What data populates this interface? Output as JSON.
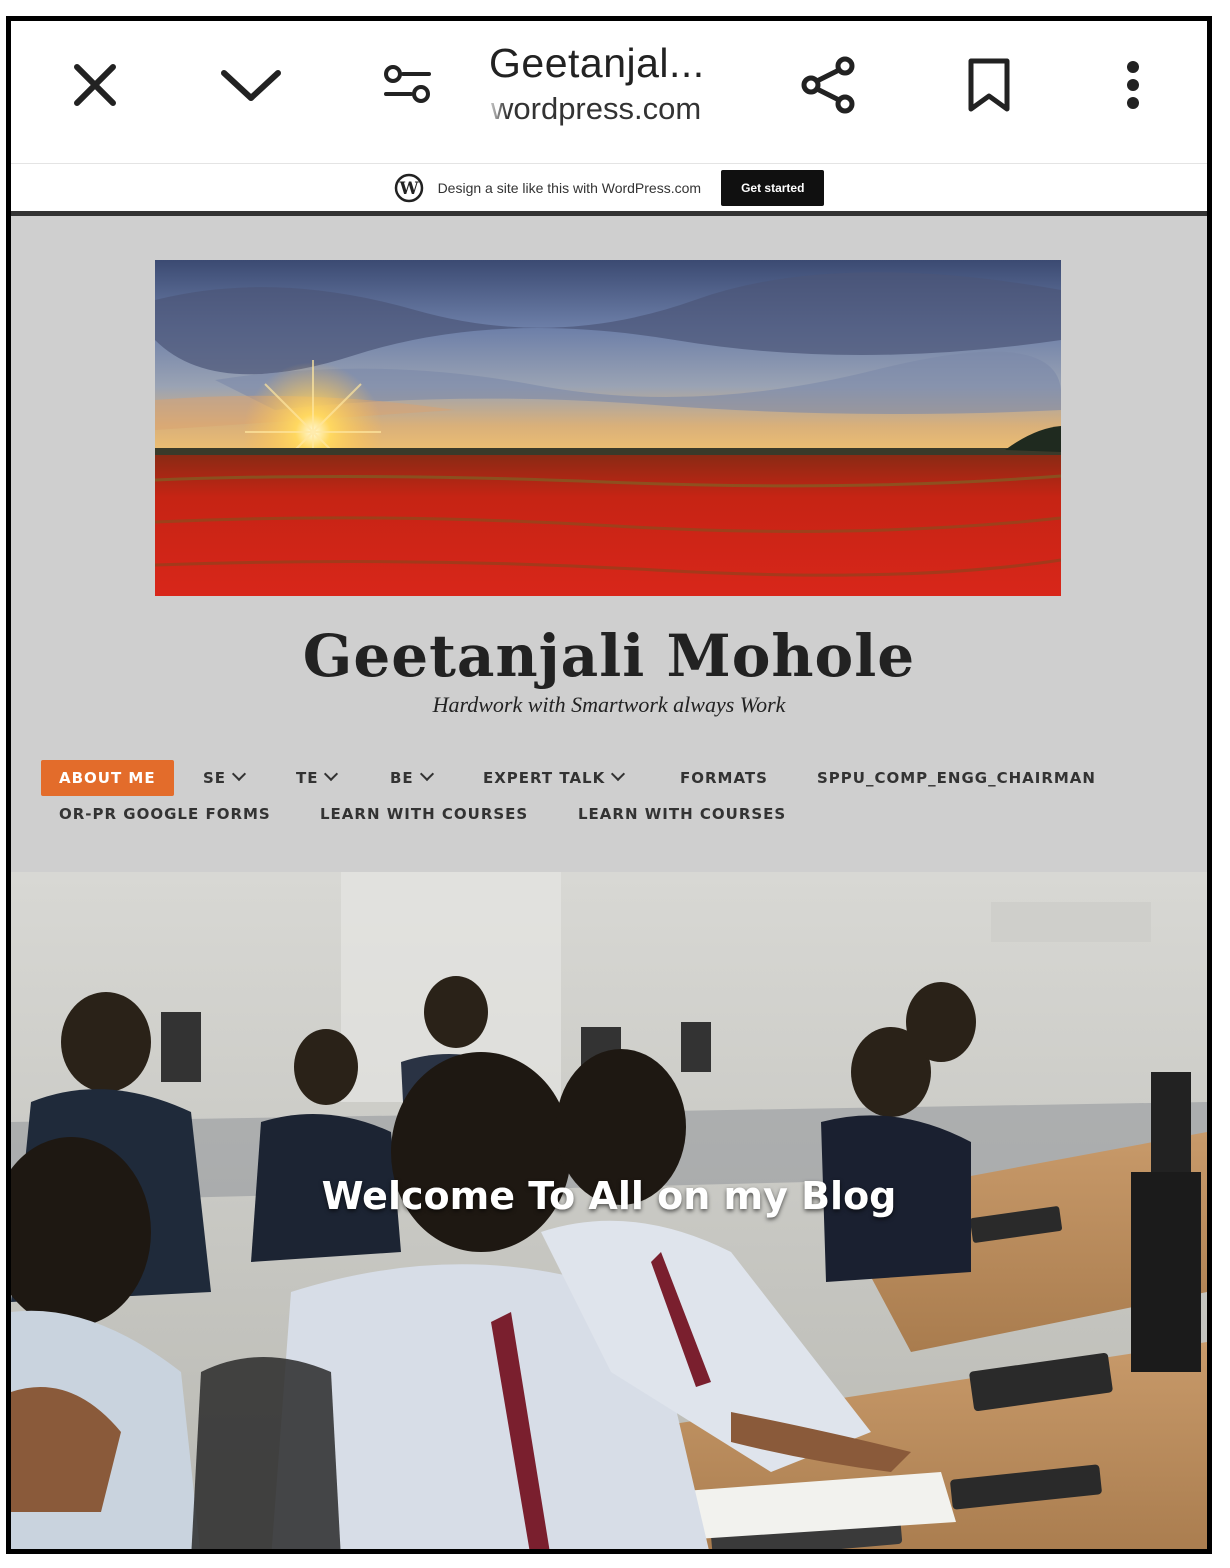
{
  "browser": {
    "title": "Geetanjal...",
    "domain": "wordpress.com",
    "icons": [
      "close-icon",
      "chevron-down-icon",
      "tune-icon",
      "share-icon",
      "bookmark-icon",
      "more-vert-icon"
    ]
  },
  "promo": {
    "text": "Design a site like this with WordPress.com",
    "button_label": "Get started",
    "logo": "wordpress-logo-icon"
  },
  "site": {
    "title": "Geetanjali Mohole",
    "tagline": "Hardwork with Smartwork always Work"
  },
  "nav": {
    "items": [
      {
        "label": "ABOUT ME",
        "active": true,
        "dropdown": false
      },
      {
        "label": "SE",
        "dropdown": true
      },
      {
        "label": "TE",
        "dropdown": true
      },
      {
        "label": "BE",
        "dropdown": true
      },
      {
        "label": "EXPERT TALK",
        "dropdown": true
      },
      {
        "label": "FORMATS",
        "dropdown": false
      },
      {
        "label": "SPPU_COMP_ENGG_CHAIRMAN",
        "dropdown": false
      },
      {
        "label": "OR-PR GOOGLE FORMS",
        "dropdown": false
      },
      {
        "label": "LEARN WITH COURSES",
        "dropdown": false
      },
      {
        "label": "LEARN WITH COURSES",
        "dropdown": false
      }
    ]
  },
  "hero": {
    "heading": "Welcome To All on my Blog"
  },
  "colors": {
    "header_bg": "#cfcfcf",
    "accent": "#e36c2b",
    "promo_button_bg": "#101010"
  }
}
